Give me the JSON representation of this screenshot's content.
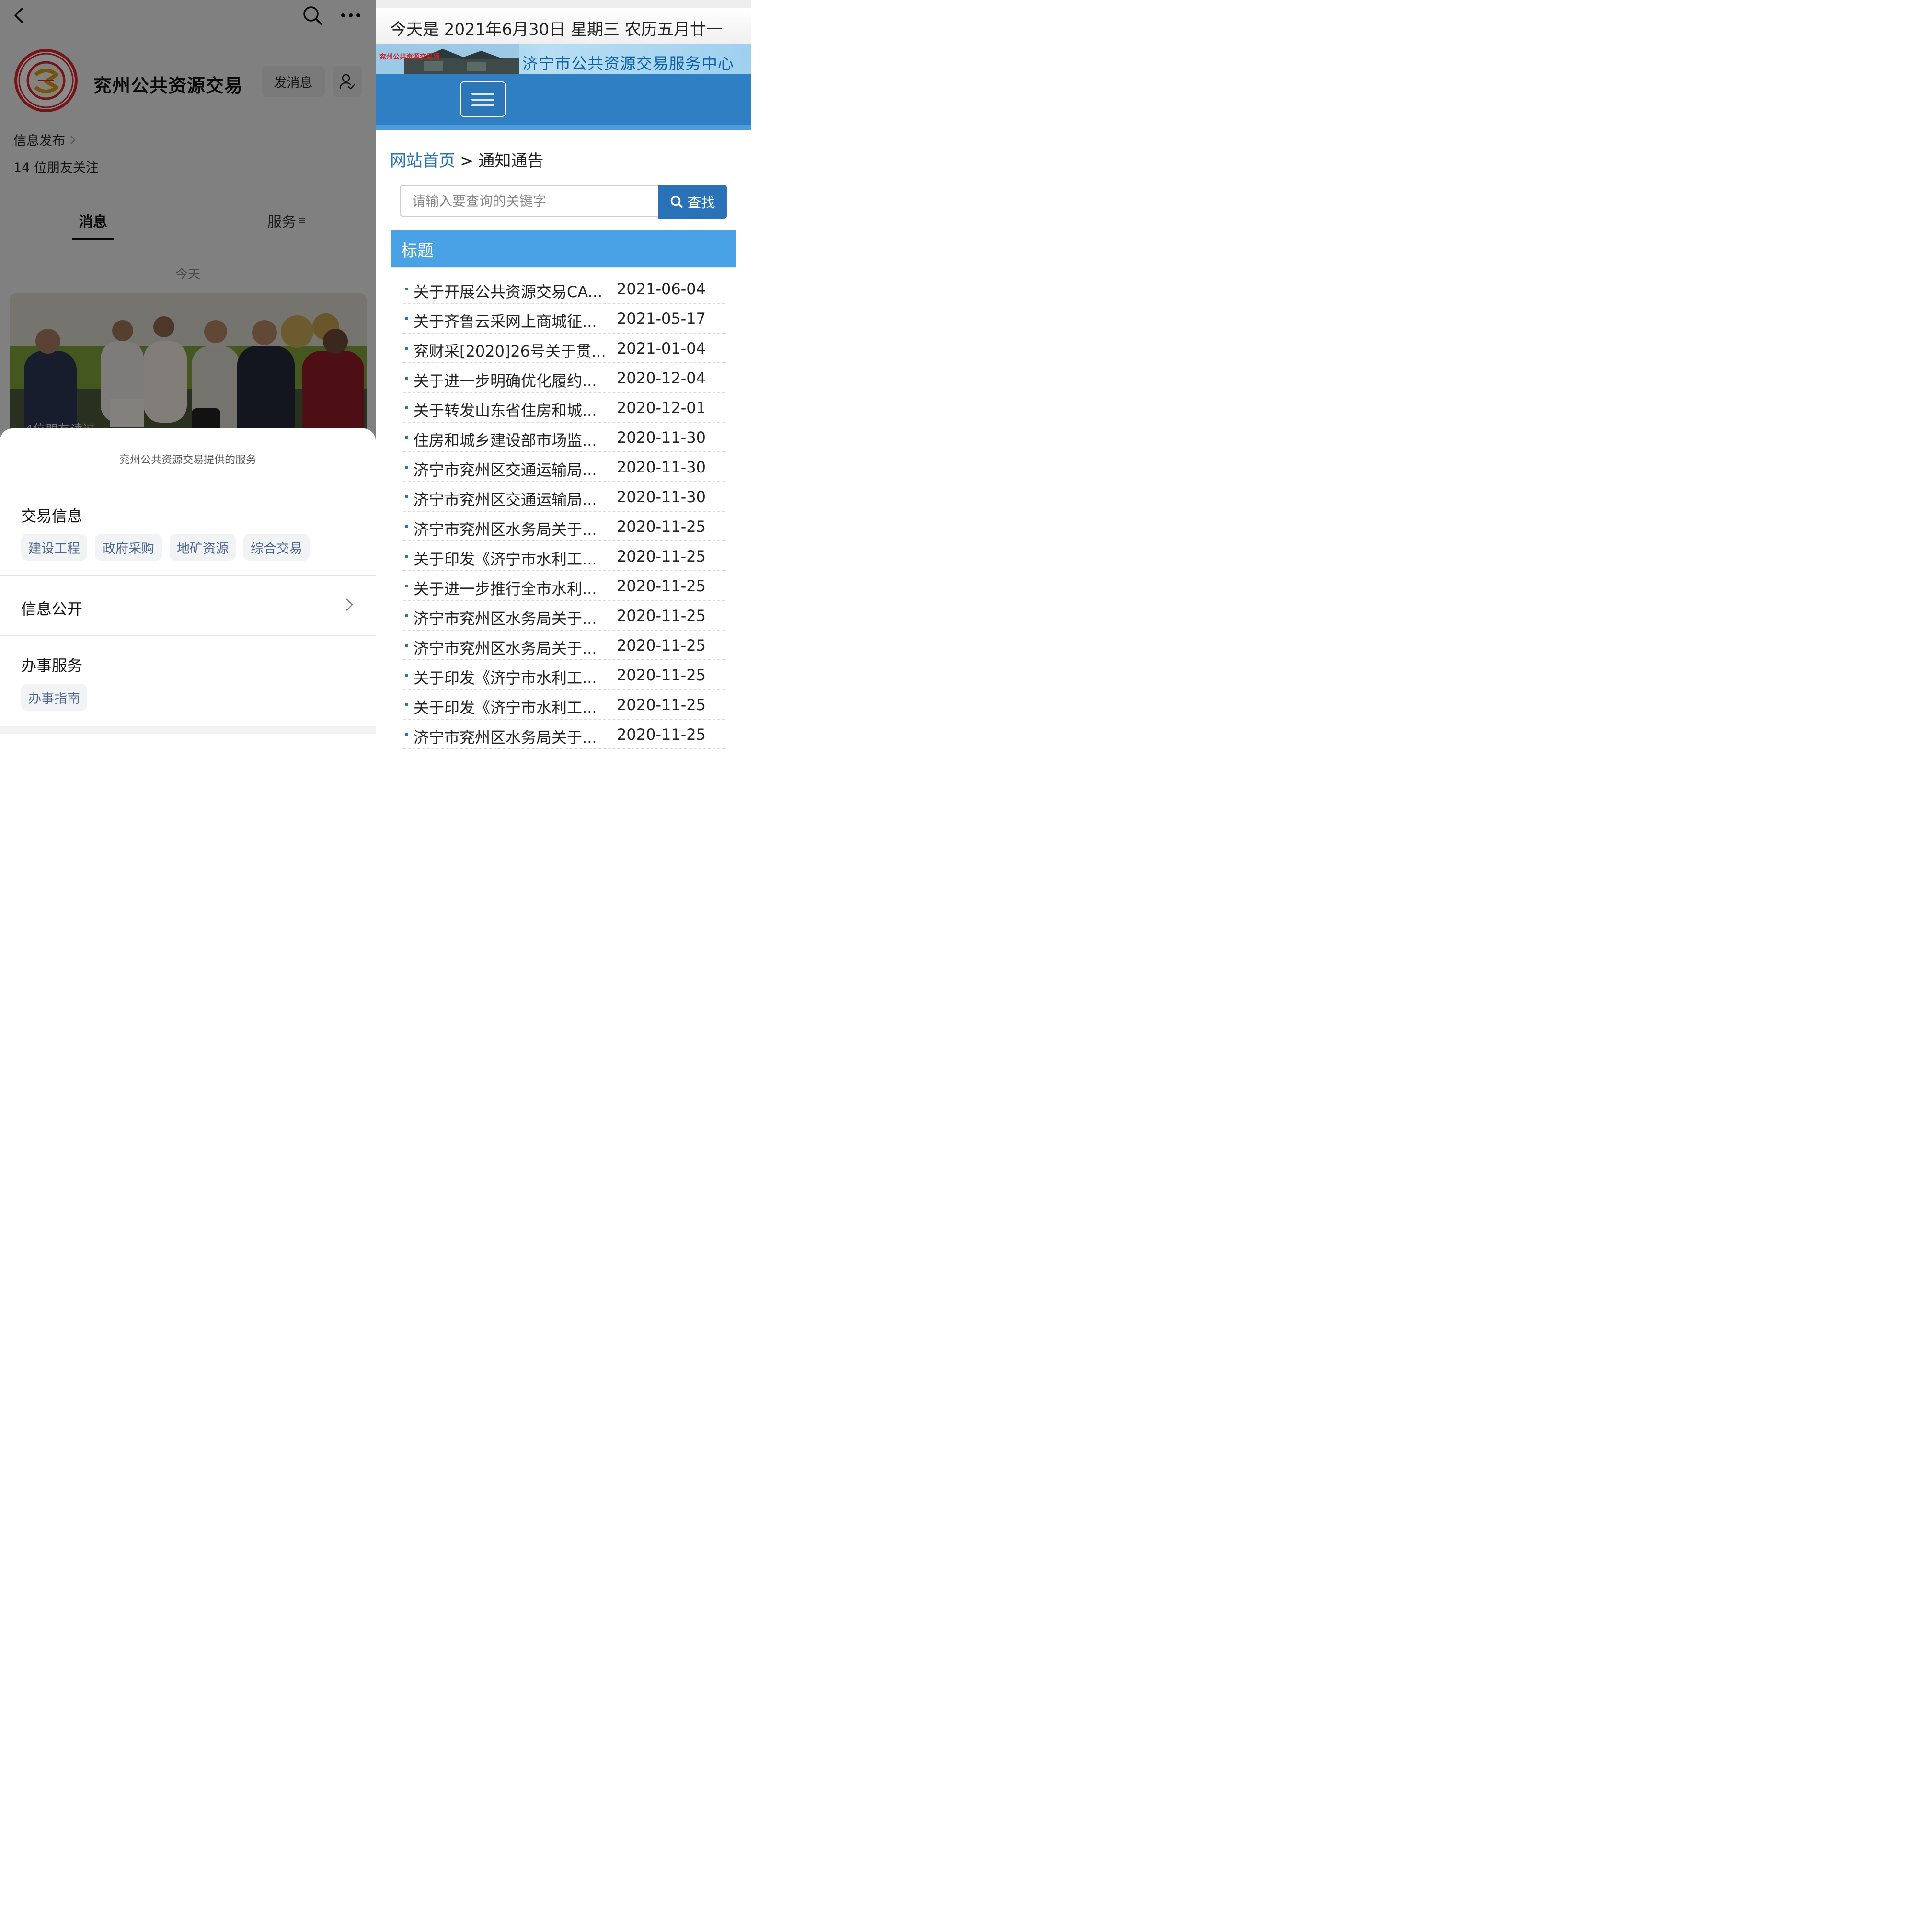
{
  "left": {
    "title": "兖州公共资源交易",
    "send_message_label": "发消息",
    "info_publish_label": "信息发布",
    "friends_follow": "14 位朋友关注",
    "tabs": {
      "messages": "消息",
      "services": "服务"
    },
    "today_label": "今天",
    "photo_caption": "4位朋友读过",
    "sheet": {
      "header": "兖州公共资源交易提供的服务",
      "section_trade": {
        "title": "交易信息",
        "chips": [
          "建设工程",
          "政府采购",
          "地矿资源",
          "综合交易"
        ]
      },
      "section_public": {
        "title": "信息公开"
      },
      "section_service": {
        "title": "办事服务",
        "chips": [
          "办事指南"
        ]
      }
    },
    "icons": {
      "back": "back-arrow-icon",
      "search": "search-icon",
      "more": "more-dots-icon",
      "follow": "person-check-icon",
      "chevron": "chevron-right-icon"
    }
  },
  "right": {
    "date_line": "今天是 2021年6月30日 星期三 农历五月廿一",
    "banner_tag": "兖州公共资源交易网",
    "banner_title": "济宁市公共资源交易服务中心",
    "breadcrumb": {
      "home": "网站首页",
      "separator": ">",
      "current": "通知通告"
    },
    "search": {
      "placeholder": "请输入要查询的关键字",
      "button_label": "查找"
    },
    "table_header": "标题",
    "notices": [
      {
        "title": "关于开展公共资源交易CA...",
        "date": "2021-06-04"
      },
      {
        "title": "关于齐鲁云采网上商城征...",
        "date": "2021-05-17"
      },
      {
        "title": "兖财采[2020]26号关于贯...",
        "date": "2021-01-04"
      },
      {
        "title": "关于进一步明确优化履约...",
        "date": "2020-12-04"
      },
      {
        "title": "关于转发山东省住房和城...",
        "date": "2020-12-01"
      },
      {
        "title": "住房和城乡建设部市场监...",
        "date": "2020-11-30"
      },
      {
        "title": "济宁市兖州区交通运输局...",
        "date": "2020-11-30"
      },
      {
        "title": "济宁市兖州区交通运输局...",
        "date": "2020-11-30"
      },
      {
        "title": "济宁市兖州区水务局关于...",
        "date": "2020-11-25"
      },
      {
        "title": "关于印发《济宁市水利工...",
        "date": "2020-11-25"
      },
      {
        "title": "关于进一步推行全市水利...",
        "date": "2020-11-25"
      },
      {
        "title": "济宁市兖州区水务局关于...",
        "date": "2020-11-25"
      },
      {
        "title": "济宁市兖州区水务局关于...",
        "date": "2020-11-25"
      },
      {
        "title": "关于印发《济宁市水利工...",
        "date": "2020-11-25"
      },
      {
        "title": "关于印发《济宁市水利工...",
        "date": "2020-11-25"
      },
      {
        "title": "济宁市兖州区水务局关于...",
        "date": "2020-11-25"
      }
    ],
    "colors": {
      "nav_blue": "#2f7fc4",
      "header_blue": "#4aa2e6",
      "link_blue": "#2a72b8"
    }
  }
}
